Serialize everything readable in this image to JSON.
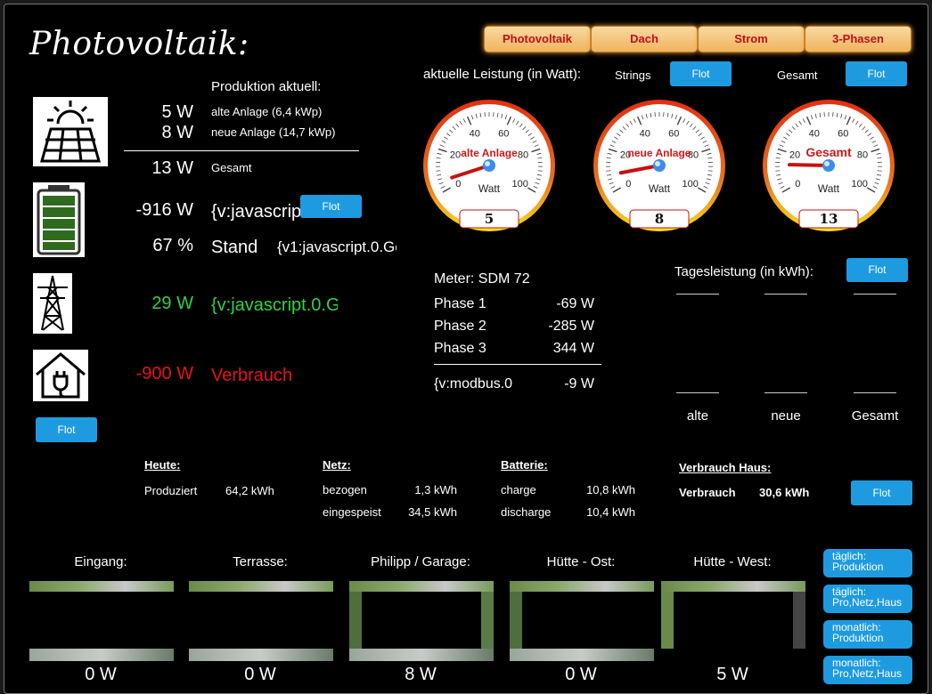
{
  "page_title": "Photovoltaik:",
  "nav": [
    "Photovoltaik",
    "Dach",
    "Strom",
    "3-Phasen"
  ],
  "flot": "Flot",
  "left": {
    "production_header": "Produktion aktuell:",
    "alt_value": "5 W",
    "alt_label": "alte Anlage (6,4 kWp)",
    "neu_value": "8 W",
    "neu_label": "neue Anlage (14,7 kWp)",
    "total_value": "13 W",
    "total_label": "Gesamt",
    "battery_value": "-916 W",
    "battery_label": "{v:javascript",
    "soc_value": "67 %",
    "soc_label": "Stand",
    "soc_extra": "{v1:javascript.0.Ge",
    "grid_value": "29 W",
    "grid_label": "{v:javascript.0.G",
    "house_value": "-900 W",
    "house_label": "Verbrauch"
  },
  "gauges": {
    "header": "aktuelle Leistung (in Watt):",
    "strings_label": "Strings",
    "gesamt_label": "Gesamt",
    "unit": "Watt",
    "ticks": [
      "0",
      "20",
      "40",
      "60",
      "80",
      "100"
    ],
    "items": [
      {
        "name": "alte Anlage",
        "value": "5",
        "fraction": 0.05
      },
      {
        "name": "neue Anlage",
        "value": "8",
        "fraction": 0.08
      },
      {
        "name": "Gesamt",
        "value": "13",
        "fraction": 0.13
      }
    ]
  },
  "meter": {
    "title": "Meter: SDM 72",
    "rows": [
      {
        "label": "Phase 1",
        "value": "-69 W"
      },
      {
        "label": "Phase 2",
        "value": "-285 W"
      },
      {
        "label": "Phase 3",
        "value": "344 W"
      }
    ],
    "total_label": "{v:modbus.0",
    "total_value": "-9 W"
  },
  "daily": {
    "header": "Tagesleistung (in kWh):",
    "labels": [
      "alte",
      "neue",
      "Gesamt"
    ]
  },
  "today": {
    "header": "Heute:",
    "produced_label": "Produziert",
    "produced_value": "64,2 kWh"
  },
  "netz": {
    "header": "Netz:",
    "bezogen_label": "bezogen",
    "bezogen_value": "1,3 kWh",
    "eingespeist_label": "eingespeist",
    "eingespeist_value": "34,5 kWh"
  },
  "batterie": {
    "header": "Batterie:",
    "charge_label": "charge",
    "charge_value": "10,8 kWh",
    "discharge_label": "discharge",
    "discharge_value": "10,4 kWh"
  },
  "verbrauch": {
    "header": "Verbrauch Haus:",
    "label": "Verbrauch",
    "value": "30,6 kWh"
  },
  "cameras": [
    {
      "name": "Eingang:",
      "value": "0 W"
    },
    {
      "name": "Terrasse:",
      "value": "0 W"
    },
    {
      "name": "Philipp / Garage:",
      "value": "8 W"
    },
    {
      "name": "Hütte - Ost:",
      "value": "0 W"
    },
    {
      "name": "Hütte - West:",
      "value": "5 W"
    }
  ],
  "side_buttons": [
    {
      "line1": "täglich:",
      "line2": "Produktion"
    },
    {
      "line1": "täglich:",
      "line2": "Pro,Netz,Haus"
    },
    {
      "line1": "monatlich:",
      "line2": "Produktion"
    },
    {
      "line1": "monatlich:",
      "line2": "Pro,Netz,Haus"
    }
  ],
  "colors": {
    "accent": "#1e9be0",
    "positive": "#2fd24a",
    "negative": "#e8141a",
    "nav_text": "#c0101a"
  }
}
